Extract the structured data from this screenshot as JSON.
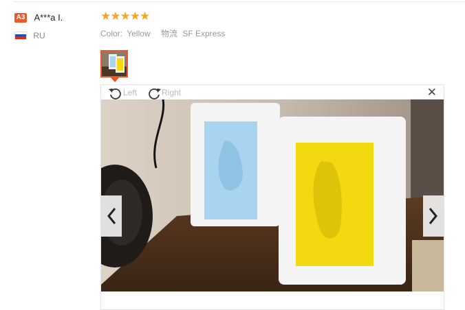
{
  "review": {
    "user": {
      "level_badge": "A3",
      "name": "A***a I.",
      "country_code": "RU"
    },
    "rating": {
      "stars": 5,
      "star_glyphs": "★★★★★"
    },
    "attributes": {
      "color_label": "Color:",
      "color_value": "Yellow",
      "shipping_label": "物流",
      "shipping_value": "SF Express"
    }
  },
  "viewer": {
    "rotate_left_label": "Left",
    "rotate_right_label": "Right",
    "close_glyph": "✕"
  },
  "icons": {
    "rotate_left": "rotate-left-icon",
    "rotate_right": "rotate-right-icon",
    "close": "close-icon",
    "prev": "chevron-left-icon",
    "next": "chevron-right-icon"
  },
  "colors": {
    "accent": "#e8592d",
    "star": "#f5a623",
    "muted": "#999999"
  }
}
